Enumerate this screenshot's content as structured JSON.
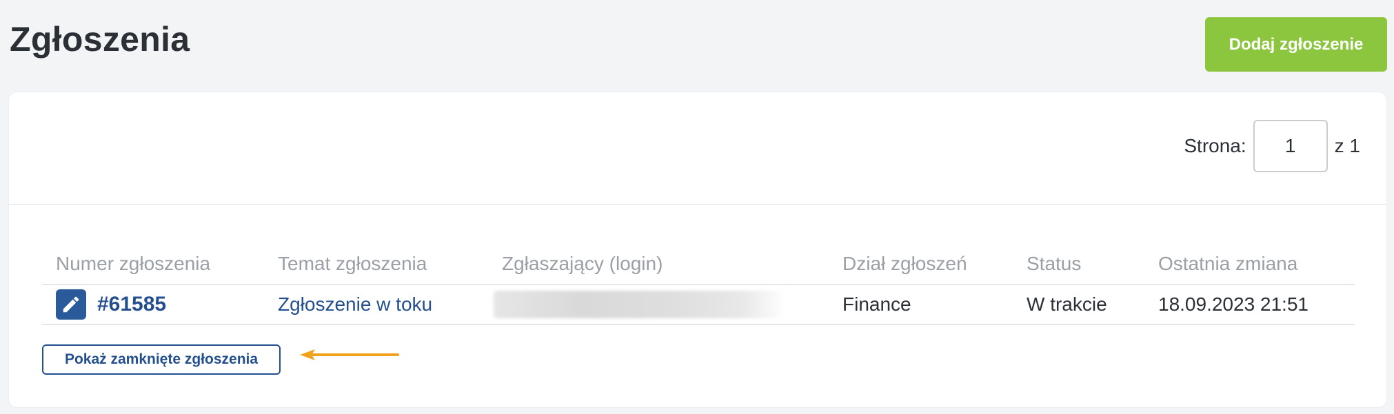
{
  "header": {
    "title": "Zgłoszenia",
    "add_button_label": "Dodaj zgłoszenie"
  },
  "pagination": {
    "label": "Strona:",
    "current_page": "1",
    "total_label": "z 1"
  },
  "table": {
    "columns": [
      "Numer zgłoszenia",
      "Temat zgłoszenia",
      "Zgłaszający (login)",
      "Dział zgłoszeń",
      "Status",
      "Ostatnia zmiana"
    ],
    "rows": [
      {
        "number": "#61585",
        "subject": "Zgłoszenie w toku",
        "requester": "",
        "department": "Finance",
        "status": "W trakcie",
        "last_change": "18.09.2023 21:51"
      }
    ]
  },
  "footer": {
    "show_closed_label": "Pokaż zamknięte zgłoszenia"
  },
  "icons": {
    "edit": "pencil-icon",
    "annotation": "arrow-left-icon"
  },
  "colors": {
    "accent": "#234f8e",
    "add_button": "#8cc63f",
    "annotation_arrow": "#f0a21b"
  }
}
